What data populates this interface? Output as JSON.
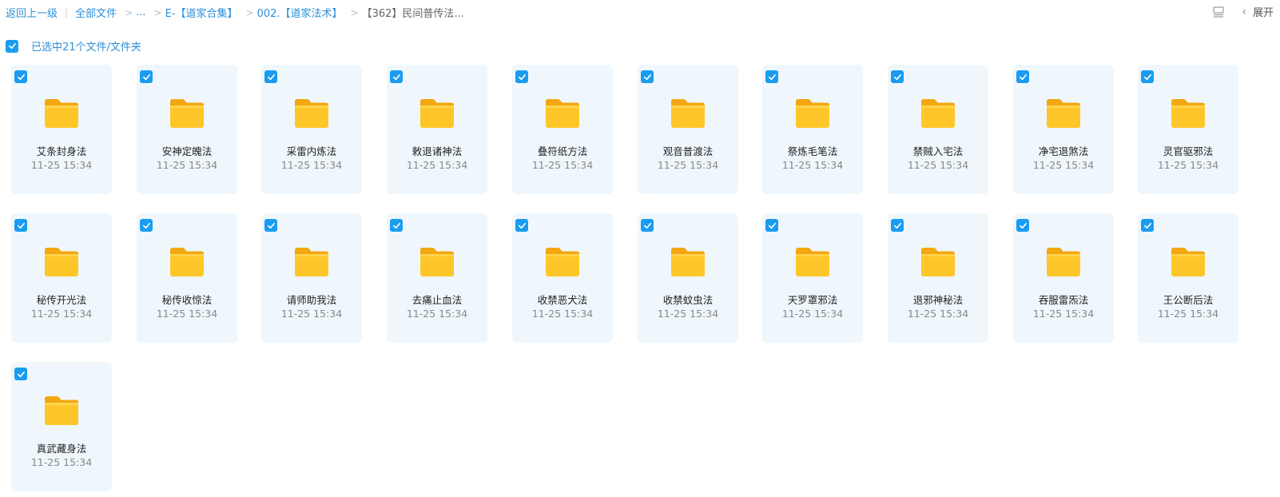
{
  "breadcrumb": {
    "back": "返回上一级",
    "items": [
      "全部文件",
      "...",
      "E-【道家合集】",
      "002.【道家法术】"
    ],
    "current": "【362】民间普传法..."
  },
  "toolbar": {
    "list_icon": "list-view-icon",
    "expand_label": "展开"
  },
  "selection": {
    "checked": true,
    "label": "已选中21个文件/文件夹"
  },
  "colors": {
    "accent": "#1a9cf0",
    "link": "#2d8fd8",
    "card_bg": "#eff7fc",
    "folder": "#ffc629"
  },
  "files": [
    {
      "name": "艾条封身法",
      "date": "11-25 15:34",
      "checked": true
    },
    {
      "name": "安神定魄法",
      "date": "11-25 15:34",
      "checked": true
    },
    {
      "name": "采雷内炼法",
      "date": "11-25 15:34",
      "checked": true
    },
    {
      "name": "敕退诸神法",
      "date": "11-25 15:34",
      "checked": true
    },
    {
      "name": "叠符纸方法",
      "date": "11-25 15:34",
      "checked": true
    },
    {
      "name": "观音普渡法",
      "date": "11-25 15:34",
      "checked": true
    },
    {
      "name": "祭炼毛笔法",
      "date": "11-25 15:34",
      "checked": true
    },
    {
      "name": "禁贼入宅法",
      "date": "11-25 15:34",
      "checked": true
    },
    {
      "name": "净宅退煞法",
      "date": "11-25 15:34",
      "checked": true
    },
    {
      "name": "灵官驱邪法",
      "date": "11-25 15:34",
      "checked": true
    },
    {
      "name": "秘传开光法",
      "date": "11-25 15:34",
      "checked": true
    },
    {
      "name": "秘传收惊法",
      "date": "11-25 15:34",
      "checked": true
    },
    {
      "name": "请师助我法",
      "date": "11-25 15:34",
      "checked": true
    },
    {
      "name": "去痛止血法",
      "date": "11-25 15:34",
      "checked": true
    },
    {
      "name": "收禁恶犬法",
      "date": "11-25 15:34",
      "checked": true
    },
    {
      "name": "收禁蚊虫法",
      "date": "11-25 15:34",
      "checked": true
    },
    {
      "name": "天罗罩邪法",
      "date": "11-25 15:34",
      "checked": true
    },
    {
      "name": "退邪神秘法",
      "date": "11-25 15:34",
      "checked": true
    },
    {
      "name": "吞服雷炁法",
      "date": "11-25 15:34",
      "checked": true
    },
    {
      "name": "王公断后法",
      "date": "11-25 15:34",
      "checked": true
    },
    {
      "name": "真武藏身法",
      "date": "11-25 15:34",
      "checked": true
    }
  ]
}
